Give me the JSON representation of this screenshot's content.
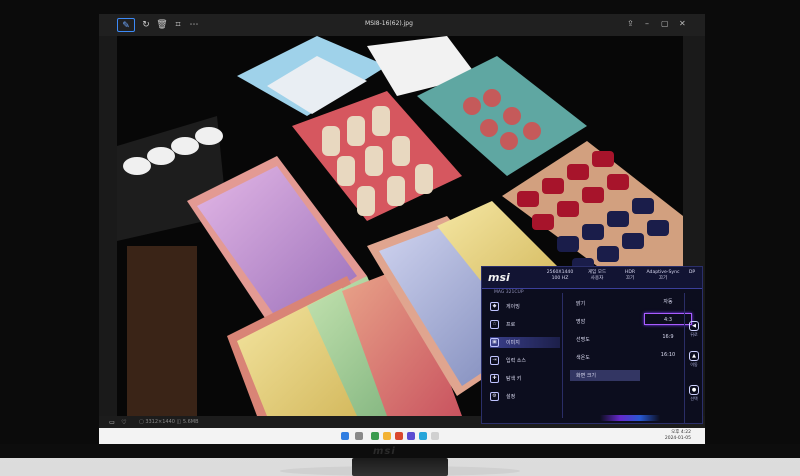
{
  "viewer": {
    "file_name": "MSI8-16(62).jpg",
    "toolbar": {
      "edit_icon": "edit-icon",
      "rotate_icon": "rotate-icon",
      "delete_icon": "delete-icon",
      "crop_icon": "crop-icon"
    },
    "status": "▢ 3312×1440  ◫ 5.6MB"
  },
  "osd": {
    "logo": "msi",
    "header_stats": [
      {
        "line1": "2560X1440",
        "line2": "100 HZ"
      },
      {
        "line1": "게임 모드",
        "line2": "사용자"
      },
      {
        "line1": "HDR",
        "line2": "끄기"
      },
      {
        "line1": "Adaptive-Sync",
        "line2": "끄기"
      },
      {
        "line1": "DP",
        "line2": ""
      }
    ],
    "subtitle": "MAG 321CUP",
    "main_menu": [
      {
        "label": "게이밍",
        "icon": "gamepad-icon"
      },
      {
        "label": "프로",
        "icon": "star-icon"
      },
      {
        "label": "이미지",
        "icon": "image-icon",
        "selected": true
      },
      {
        "label": "입력 소스",
        "icon": "input-icon"
      },
      {
        "label": "탐색 키",
        "icon": "navigation-icon"
      },
      {
        "label": "설정",
        "icon": "settings-icon"
      }
    ],
    "sub_menu": [
      {
        "label": "밝기"
      },
      {
        "label": "명암"
      },
      {
        "label": "선명도"
      },
      {
        "label": "색온도"
      },
      {
        "label": "화면 크기",
        "selected": true
      }
    ],
    "options": [
      {
        "label": "자동"
      },
      {
        "label": "4:3",
        "selected": true
      },
      {
        "label": "16:9"
      },
      {
        "label": "16:10"
      }
    ],
    "nav": [
      {
        "label": "뒤로",
        "icon": "back-icon"
      },
      {
        "label": "이동",
        "icon": "move-icon"
      },
      {
        "label": "선택",
        "icon": "select-icon"
      }
    ]
  },
  "taskbar": {
    "clock_time": "오후 4:22",
    "clock_date": "2024-01-05"
  },
  "monitor": {
    "brand": "msi"
  }
}
